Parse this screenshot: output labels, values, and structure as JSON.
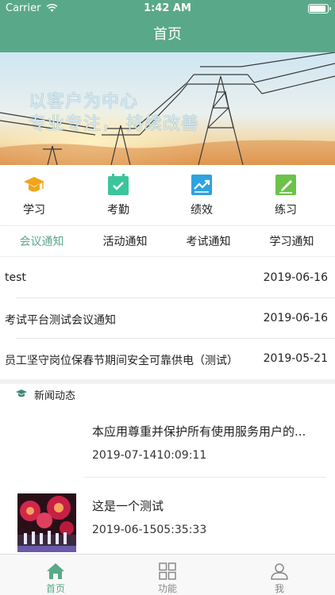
{
  "status_bar": {
    "carrier": "Carrier",
    "time": "1:42 AM"
  },
  "nav": {
    "title": "首页"
  },
  "banner": {
    "slogan_line1": "以客户为中心",
    "slogan_line2": "专业专注， 持续改善"
  },
  "quick_actions": [
    {
      "label": "学习",
      "icon": "graduation-cap-icon",
      "color": "#f2a516"
    },
    {
      "label": "考勤",
      "icon": "calendar-check-icon",
      "color": "#3cc59a"
    },
    {
      "label": "绩效",
      "icon": "trend-chart-icon",
      "color": "#2fa2e0"
    },
    {
      "label": "练习",
      "icon": "pencil-note-icon",
      "color": "#6cc24a"
    }
  ],
  "notice_tabs": [
    {
      "label": "会议通知",
      "active": true
    },
    {
      "label": "活动通知",
      "active": false
    },
    {
      "label": "考试通知",
      "active": false
    },
    {
      "label": "学习通知",
      "active": false
    }
  ],
  "notices": [
    {
      "title": "test",
      "date": "2019-06-16"
    },
    {
      "title": "考试平台测试会议通知",
      "date": "2019-06-16"
    },
    {
      "title": "员工坚守岗位保春节期间安全可靠供电（测试）",
      "date": "2019-05-21"
    }
  ],
  "news_section": {
    "title": "新闻动态"
  },
  "news": [
    {
      "title": "本应用尊重并保护所有使用服务用户的...",
      "time": "2019-07-1410:09:11",
      "has_thumb": false
    },
    {
      "title": "这是一个测试",
      "time": "2019-06-1505:35:33",
      "has_thumb": true
    }
  ],
  "tab_bar": [
    {
      "label": "首页",
      "icon": "home-icon",
      "active": true
    },
    {
      "label": "功能",
      "icon": "grid-icon",
      "active": false
    },
    {
      "label": "我",
      "icon": "user-icon",
      "active": false
    }
  ],
  "colors": {
    "brand": "#5aa88a"
  }
}
